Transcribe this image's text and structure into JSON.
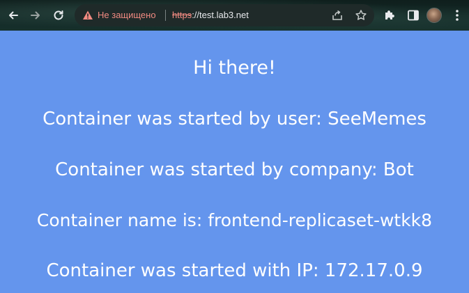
{
  "browser": {
    "security_label": "Не защищено",
    "url_scheme": "https",
    "url_rest": "://test.lab3.net",
    "icons": {
      "back": "back-arrow-icon",
      "forward": "forward-arrow-icon",
      "reload": "reload-icon",
      "warning": "warning-icon",
      "share": "share-icon",
      "bookmark": "star-icon",
      "extensions": "puzzle-icon",
      "side_panel": "side-panel-icon",
      "menu": "kebab-menu-icon"
    },
    "colors": {
      "warning": "#f28b82",
      "toolbar": "#16302c"
    }
  },
  "page": {
    "background": "#6495ed",
    "greeting": "Hi there!",
    "user_line": "Container was started by user: SeeMemes",
    "company_line": "Container was started by company: Bot",
    "name_line": "Container name is: frontend-replicaset-wtkk8",
    "ip_line": "Container was started with IP: 172.17.0.9"
  }
}
